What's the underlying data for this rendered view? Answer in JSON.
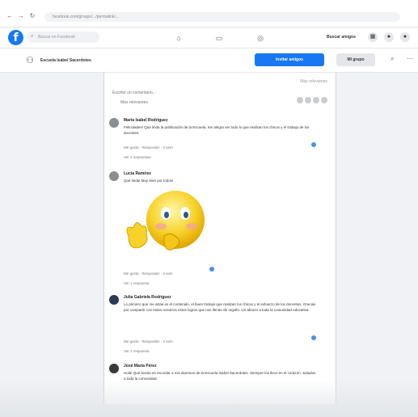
{
  "browser": {
    "url": "facebook.com/groups/.../permalink/..."
  },
  "facebook": {
    "logo": "f",
    "search_placeholder": "Buscar en Facebook",
    "invite_label": "Buscar amigos"
  },
  "group": {
    "name": "Escuela Isabel Sacerdotes",
    "primary_button": "Invitar amigos",
    "secondary_button": "Mi grupo"
  },
  "panel": {
    "top_right_note": "Más relevantes",
    "sort_label": "Escribir un comentario...",
    "sort_sub": "Más relevantes"
  },
  "comments": [
    {
      "author": "María Isabel Rodríguez",
      "text": "Felicidades! Qué linda la publicación de la Escuela, me alegra ver todo lo que realizan los chicos y el trabajo de los docentes.",
      "meta": "Me gusta · Responder · 2 sem",
      "replies": "Ver 2 respuestas"
    },
    {
      "author": "Lucía Ramírez",
      "text": "Qué linda! Muy bien por todos!",
      "meta": "Me gusta · Responder · 2 sem",
      "replies": "Ver 1 respuesta"
    },
    {
      "author": "Julia Gabriela Rodríguez",
      "text": "Lo primero que me atrae es el contenido, el buen trabajo que realizan los chicos y el esfuerzo de los docentes. Gracias por compartir con todos nosotros estos logros que nos llenan de orgullo. Un abrazo a toda la comunidad educativa.",
      "meta": "Me gusta · Responder · 2 sem",
      "replies": "Ver 1 respuesta"
    },
    {
      "author": "José María Pérez",
      "text": "Hola! Qué bonito es recordar a mis alumnos de la Escuela Isabel Sacerdotes. Siempre los llevo en el corazón. Saludos a toda la comunidad.",
      "meta": "",
      "replies": ""
    }
  ],
  "icons": {
    "back": "arrow-left-icon",
    "forward": "arrow-right-icon",
    "reload": "reload-icon"
  },
  "colors": {
    "brand": "#1877f2",
    "panel_bg": "#ffffff",
    "page_bg": "#f0f2f5"
  }
}
